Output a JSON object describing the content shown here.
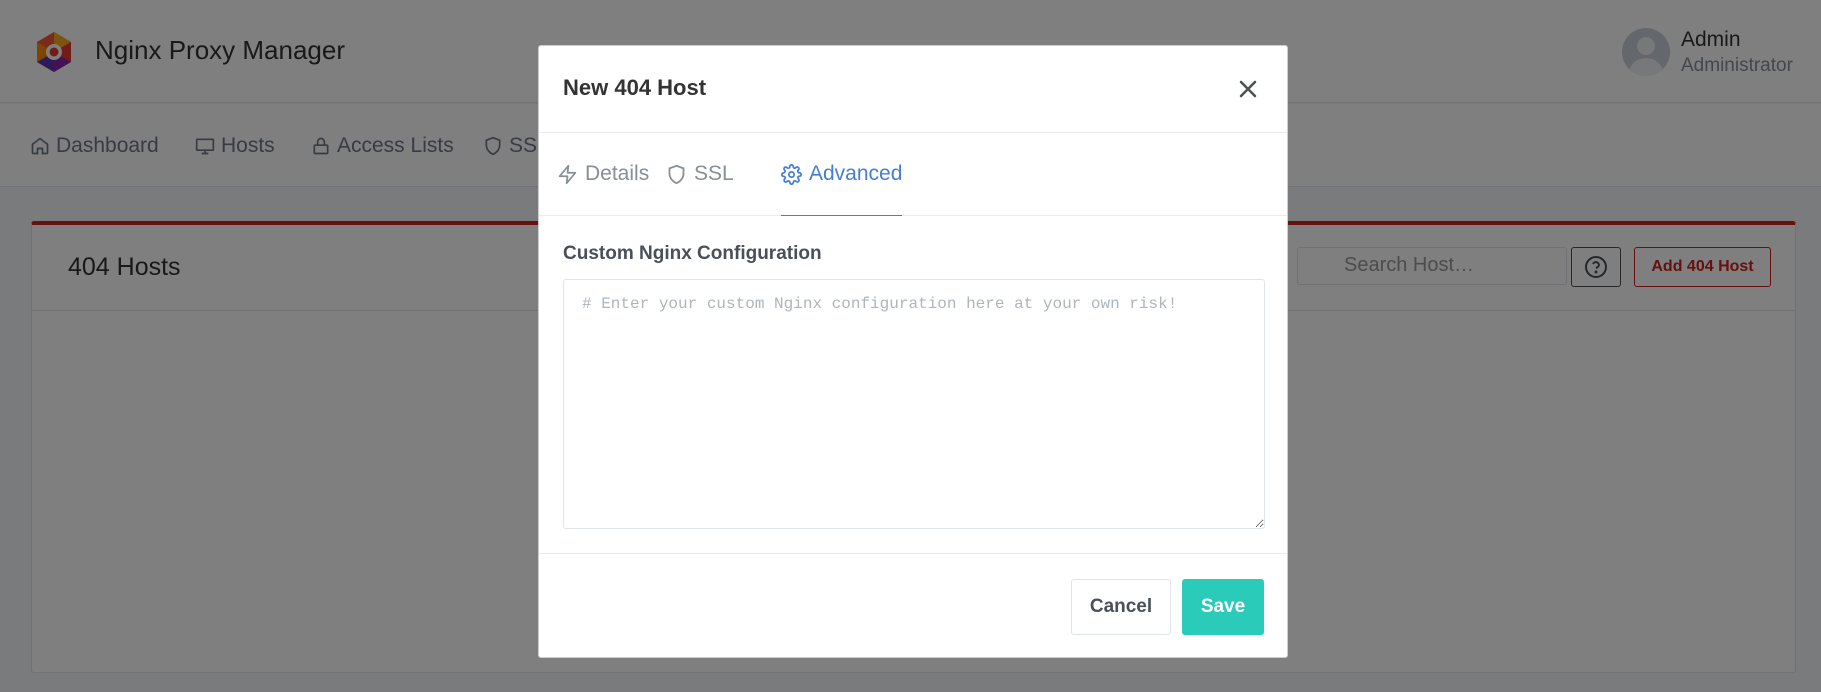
{
  "app": {
    "brand": "Nginx Proxy Manager",
    "user_name": "Admin",
    "user_role": "Administrator"
  },
  "nav": {
    "items": [
      {
        "label": "Dashboard",
        "icon": "home-icon"
      },
      {
        "label": "Hosts",
        "icon": "monitor-icon"
      },
      {
        "label": "Access Lists",
        "icon": "lock-icon"
      },
      {
        "label": "SSL",
        "icon": "shield-icon"
      }
    ]
  },
  "card": {
    "title": "404 Hosts",
    "search_placeholder": "Search Host…",
    "add_button": "Add 404 Host"
  },
  "modal": {
    "title": "New 404 Host",
    "tabs": [
      {
        "label": "Details",
        "icon": "zap-icon",
        "active": false
      },
      {
        "label": "SSL",
        "icon": "shield-icon",
        "active": false
      },
      {
        "label": "Advanced",
        "icon": "gear-icon",
        "active": true
      }
    ],
    "field_label": "Custom Nginx Configuration",
    "config_value": "",
    "config_placeholder": "# Enter your custom Nginx configuration here at your own risk!",
    "cancel_label": "Cancel",
    "save_label": "Save"
  },
  "colors": {
    "accent": "#467fcf",
    "save": "#2bcbba",
    "danger": "#cd201f"
  }
}
